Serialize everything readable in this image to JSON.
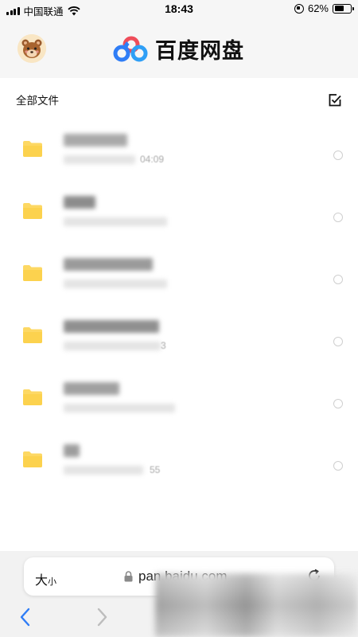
{
  "status_bar": {
    "carrier": "中国联通",
    "time": "18:43",
    "battery_percent": "62%",
    "battery_level": 0.62
  },
  "header": {
    "brand_name": "百度网盘",
    "avatar_icon": "bear-avatar-icon",
    "logo_icon": "baidu-netdisk-logo-icon"
  },
  "section": {
    "title": "全部文件",
    "select_icon": "checkbox-icon"
  },
  "files": [
    {
      "name": "",
      "meta": "",
      "meta_suffix": "04:09"
    },
    {
      "name": "",
      "meta": "",
      "meta_suffix": ""
    },
    {
      "name": "",
      "meta": "",
      "meta_suffix": ""
    },
    {
      "name": "",
      "meta": "",
      "meta_suffix": "3"
    },
    {
      "name": "",
      "meta": "",
      "meta_suffix": ""
    },
    {
      "name": "",
      "meta": "",
      "meta_suffix": "55"
    }
  ],
  "browser": {
    "text_size_label": "大",
    "text_size_small": "小",
    "url": "pan.baidu.com",
    "lock_icon": "lock-icon",
    "reload_icon": "reload-icon",
    "back_icon": "chevron-left-icon",
    "forward_icon": "chevron-right-icon"
  },
  "colors": {
    "folder": "#fdd863",
    "accent_blue": "#2f7df6",
    "header_bg": "#f6f6f6"
  }
}
